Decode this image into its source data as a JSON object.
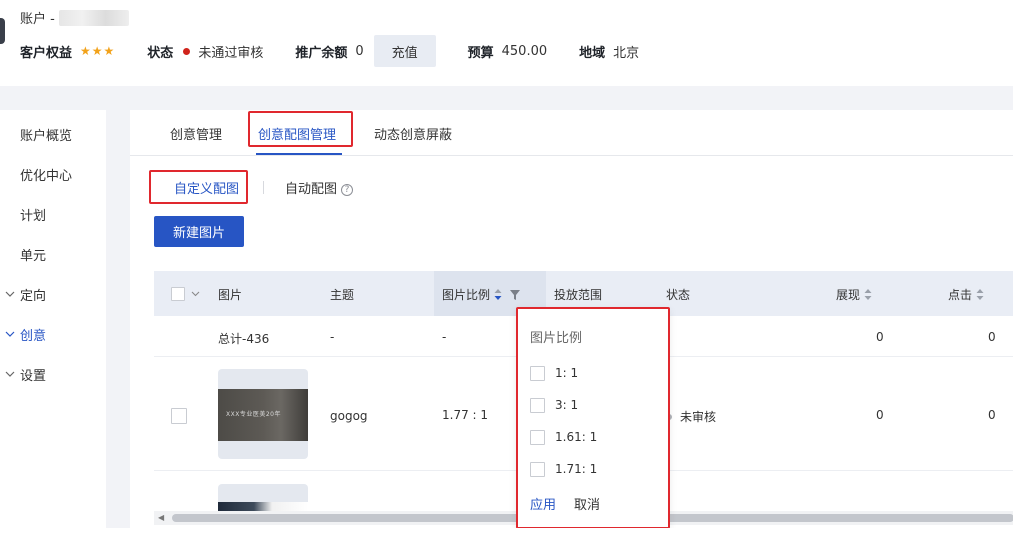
{
  "header": {
    "account_label": "账户 -",
    "customer_rights_label": "客户权益",
    "stars": "★★★",
    "status_label": "状态",
    "status_value": "未通过审核",
    "balance_label": "推广余额",
    "balance_value": "0",
    "recharge_label": "充值",
    "budget_label": "预算",
    "budget_value": "450.00",
    "region_label": "地域",
    "region_value": "北京"
  },
  "sidebar": {
    "items": [
      {
        "label": "账户概览"
      },
      {
        "label": "优化中心"
      },
      {
        "label": "计划"
      },
      {
        "label": "单元"
      },
      {
        "label": "定向"
      },
      {
        "label": "创意"
      },
      {
        "label": "设置"
      }
    ]
  },
  "tabs": [
    {
      "label": "创意管理"
    },
    {
      "label": "创意配图管理"
    },
    {
      "label": "动态创意屏蔽"
    }
  ],
  "subtabs": [
    {
      "label": "自定义配图"
    },
    {
      "label": "自动配图"
    }
  ],
  "new_image_button": "新建图片",
  "table": {
    "columns": [
      "图片",
      "主题",
      "图片比例",
      "投放范围",
      "状态",
      "展现",
      "点击"
    ],
    "total_row": {
      "label": "总计-436",
      "theme": "-",
      "ratio": "-",
      "impressions": "0",
      "clicks": "0"
    },
    "rows": [
      {
        "thumb_text": "XXX专业医美20年",
        "theme": "gogog",
        "ratio": "1.77 : 1",
        "status": "未审核",
        "impressions": "0",
        "clicks": "0"
      }
    ]
  },
  "dropdown": {
    "title": "图片比例",
    "options": [
      "1: 1",
      "3: 1",
      "1.61: 1",
      "1.71: 1"
    ],
    "apply": "应用",
    "cancel": "取消"
  },
  "colors": {
    "accent": "#2755c4",
    "highlight_box": "#e0282e",
    "status_fail": "#d0241b",
    "star": "#f2a21a"
  }
}
